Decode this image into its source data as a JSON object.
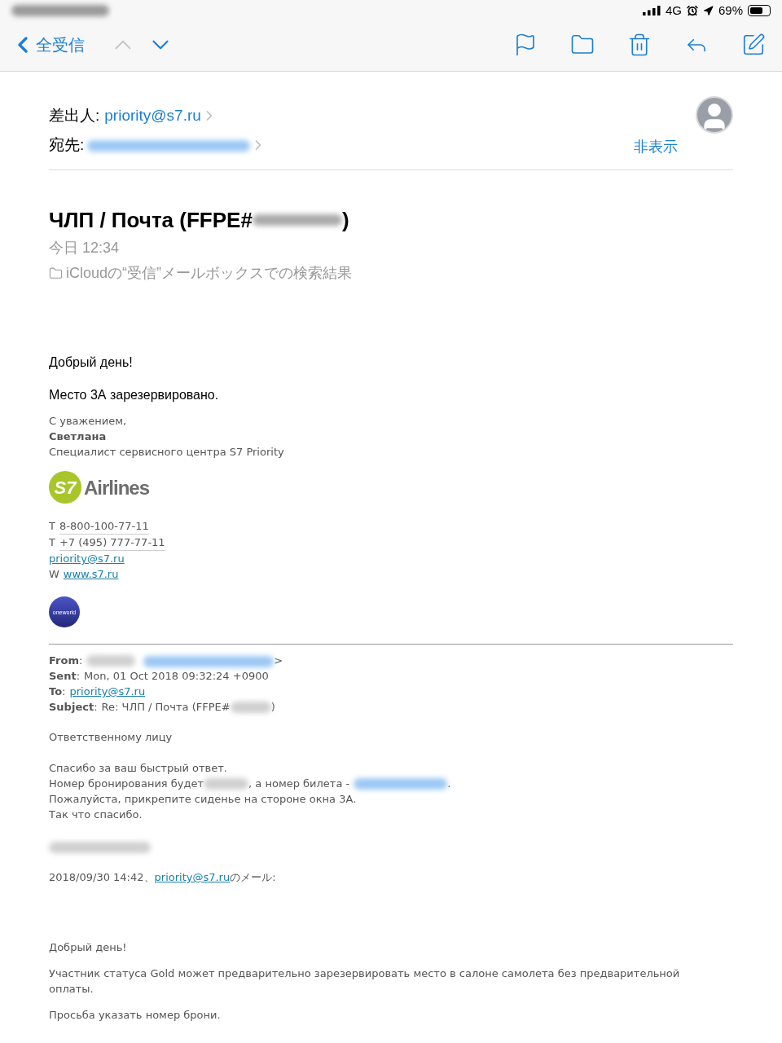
{
  "status_bar": {
    "network": "4G",
    "battery": "69%"
  },
  "toolbar": {
    "back": "全受信",
    "prev_disabled": true,
    "next_disabled": false
  },
  "header": {
    "from_label": "差出人:",
    "from": "priority@s7.ru",
    "to_label": "宛先:",
    "hide": "非表示"
  },
  "subject": {
    "start": "ЧЛП / Почта (FFPE#",
    "end": ")"
  },
  "date": "今日 12:34",
  "mailbox": "iCloudの“受信”メールボックスでの検索結果",
  "body": [
    "Добрый день!",
    "Место 3А зарезервировано."
  ],
  "signature": {
    "closing": "С уважением,",
    "name": "Светлана",
    "role": "Специалист сервисного центра S7 Priority"
  },
  "logo": {
    "mark": "S7",
    "text": "Airlines"
  },
  "contacts": [
    {
      "prefix": "T",
      "value": "8-800-100-77-11",
      "kind": "phone"
    },
    {
      "prefix": "T",
      "value": "+7 (495) 777-77-11",
      "kind": "phone"
    },
    {
      "value": "priority@s7.ru",
      "kind": "link"
    },
    {
      "prefix": "W",
      "value": "www.s7.ru",
      "kind": "link"
    }
  ],
  "alliance_badge": "oneworld",
  "quoted_header": [
    {
      "label": "From",
      "colon": ":",
      "kind": "redacted",
      "value": ">"
    },
    {
      "label": "Sent",
      "colon": ":",
      "kind": "text",
      "value": "Mon, 01 Oct 2018 09:32:24 +0900"
    },
    {
      "label": "To",
      "colon": ":",
      "kind": "link",
      "value": "priority@s7.ru"
    },
    {
      "label": "Subject",
      "colon": ":",
      "kind": "subject",
      "value": "Re: ЧЛП / Почта (FFPE#",
      "tail": ")"
    }
  ],
  "quoted_greeting": "Ответственному лицу",
  "quoted_lines": [
    {
      "kind": "text",
      "text": "Спасибо за ваш быстрый ответ."
    },
    {
      "kind": "booking",
      "parts": [
        "Номер бронирования будет",
        ", а номер билета -",
        "."
      ]
    },
    {
      "kind": "text",
      "text": "Пожалуйста, прикрепите сиденье на стороне окна 3А."
    },
    {
      "kind": "text",
      "text": "Так что спасибо."
    }
  ],
  "reply_line": {
    "date": "2018/09/30 14:42、",
    "link": "priority@s7.ru",
    "suffix": "のメール:"
  },
  "older_body": [
    "Добрый день!",
    "Участник статуса Gold может предварительно зарезервировать место в салоне самолета без предварительной оплаты.",
    "Просьба указать номер брони."
  ]
}
